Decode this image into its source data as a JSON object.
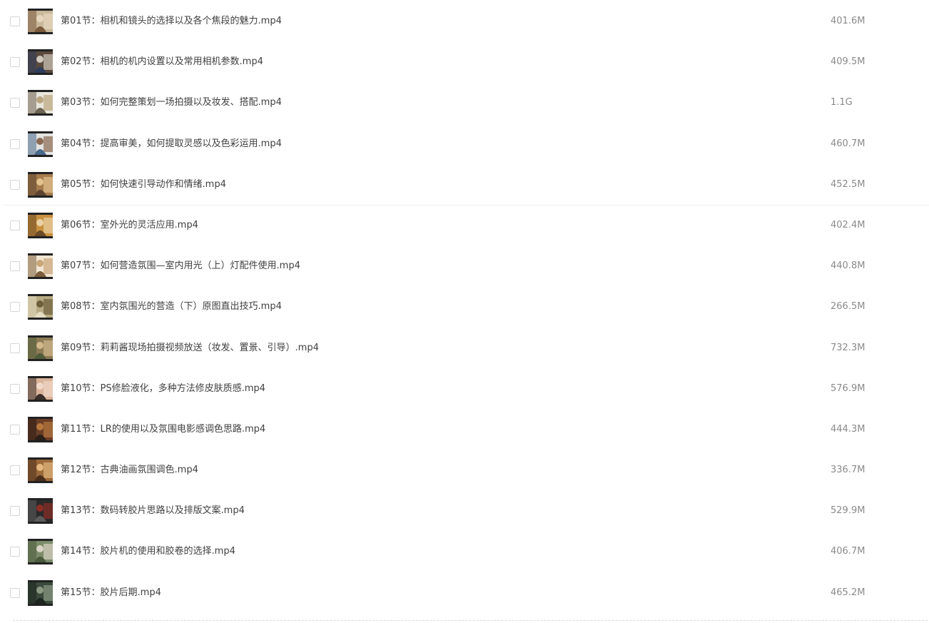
{
  "files": [
    {
      "name": "第01节：相机和镜头的选择以及各个焦段的魅力.mp4",
      "size": "401.6M",
      "thumb_colors": [
        "#c9b89a",
        "#e7d7bf",
        "#7a5a3c"
      ]
    },
    {
      "name": "第02节：相机的机内设置以及常用相机参数.mp4",
      "size": "409.5M",
      "thumb_colors": [
        "#5a4a3c",
        "#d0c8bc",
        "#2f3d5c"
      ]
    },
    {
      "name": "第03节：如何完整策划一场拍摄以及妆发、搭配.mp4",
      "size": "1.1G",
      "thumb_colors": [
        "#e9e6dc",
        "#b9a57f",
        "#6d6352"
      ]
    },
    {
      "name": "第04节：提高审美，如何提取灵感以及色彩运用.mp4",
      "size": "460.7M",
      "thumb_colors": [
        "#e3e3e0",
        "#8a6a54",
        "#4a6a8c"
      ]
    },
    {
      "name": "第05节：如何快速引导动作和情绪.mp4",
      "size": "452.5M",
      "thumb_colors": [
        "#a67c4e",
        "#e2c28d",
        "#5c4430"
      ]
    },
    {
      "name": "第06节：室外光的灵活应用.mp4",
      "size": "402.4M",
      "thumb_colors": [
        "#c8913f",
        "#e9d2a5",
        "#6b4a26"
      ]
    },
    {
      "name": "第07节：如何营造氛围—室内用光（上）灯配件使用.mp4",
      "size": "440.8M",
      "thumb_colors": [
        "#f1e6d2",
        "#c9a57a",
        "#7c5e3c"
      ]
    },
    {
      "name": "第08节：室内氛围光的营造（下）原图直出技巧.mp4",
      "size": "266.5M",
      "thumb_colors": [
        "#b7ab83",
        "#6e5e3c",
        "#e5dcc2"
      ]
    },
    {
      "name": "第09节：莉莉酱现场拍摄视频放送（妆发、置景、引导）.mp4",
      "size": "732.3M",
      "thumb_colors": [
        "#8c7a55",
        "#d2b98c",
        "#4e5c3a"
      ]
    },
    {
      "name": "第10节：PS修脸液化，多种方法修皮肤质感.mp4",
      "size": "576.9M",
      "thumb_colors": [
        "#d9b39a",
        "#f0d8c8",
        "#3a2e2a"
      ]
    },
    {
      "name": "第11节：LR的使用以及氛围电影感调色思路.mp4",
      "size": "444.3M",
      "thumb_colors": [
        "#6b3e26",
        "#b7783e",
        "#2a1e18"
      ]
    },
    {
      "name": "第12节：古典油画氛围调色.mp4",
      "size": "336.7M",
      "thumb_colors": [
        "#9c6a3a",
        "#e3b77e",
        "#4a2e1c"
      ]
    },
    {
      "name": "第13节：数码转胶片思路以及排版文案.mp4",
      "size": "529.9M",
      "thumb_colors": [
        "#2a2a2a",
        "#8c2e26",
        "#5c5c5c"
      ]
    },
    {
      "name": "第14节：胶片机的使用和胶卷的选择.mp4",
      "size": "406.7M",
      "thumb_colors": [
        "#7c8c6a",
        "#d9d2c4",
        "#4a5a3c"
      ]
    },
    {
      "name": "第15节：胶片后期.mp4",
      "size": "465.2M",
      "thumb_colors": [
        "#3a4a3c",
        "#8c9a84",
        "#1e241e"
      ]
    }
  ]
}
